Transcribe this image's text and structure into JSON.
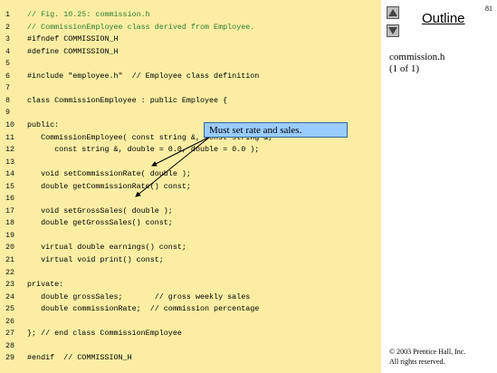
{
  "slide_number": "81",
  "outline": {
    "title": "Outline"
  },
  "file_info": {
    "name": "commission.h",
    "part": "(1 of 1)"
  },
  "callout": {
    "text": "Must set rate and sales."
  },
  "copyright": {
    "line1": "© 2003 Prentice Hall, Inc.",
    "line2": "All rights reserved."
  },
  "code_lines": [
    {
      "num": "1",
      "text": "// Fig. 10.25: commission.h"
    },
    {
      "num": "2",
      "text": "// CommissionEmployee class derived from Employee."
    },
    {
      "num": "3",
      "text": "#ifndef COMMISSION_H"
    },
    {
      "num": "4",
      "text": "#define COMMISSION_H"
    },
    {
      "num": "5",
      "text": ""
    },
    {
      "num": "6",
      "text": "#include \"employee.h\"  // Employee class definition"
    },
    {
      "num": "7",
      "text": ""
    },
    {
      "num": "8",
      "text": "class CommissionEmployee : public Employee {"
    },
    {
      "num": "9",
      "text": ""
    },
    {
      "num": "10",
      "text": "public:"
    },
    {
      "num": "11",
      "text": "   CommissionEmployee( const string &, const string &,"
    },
    {
      "num": "12",
      "text": "      const string &, double = 0.0, double = 0.0 );"
    },
    {
      "num": "13",
      "text": ""
    },
    {
      "num": "14",
      "text": "   void setCommissionRate( double );"
    },
    {
      "num": "15",
      "text": "   double getCommissionRate() const;"
    },
    {
      "num": "16",
      "text": ""
    },
    {
      "num": "17",
      "text": "   void setGrossSales( double );"
    },
    {
      "num": "18",
      "text": "   double getGrossSales() const;"
    },
    {
      "num": "19",
      "text": ""
    },
    {
      "num": "20",
      "text": "   virtual double earnings() const;"
    },
    {
      "num": "21",
      "text": "   virtual void print() const;"
    },
    {
      "num": "22",
      "text": ""
    },
    {
      "num": "23",
      "text": "private:"
    },
    {
      "num": "24",
      "text": "   double grossSales;       // gross weekly sales"
    },
    {
      "num": "25",
      "text": "   double commissionRate;  // commission percentage"
    },
    {
      "num": "26",
      "text": ""
    },
    {
      "num": "27",
      "text": "}; // end class CommissionEmployee"
    },
    {
      "num": "28",
      "text": ""
    },
    {
      "num": "29",
      "text": "#endif  // COMMISSION_H"
    }
  ]
}
